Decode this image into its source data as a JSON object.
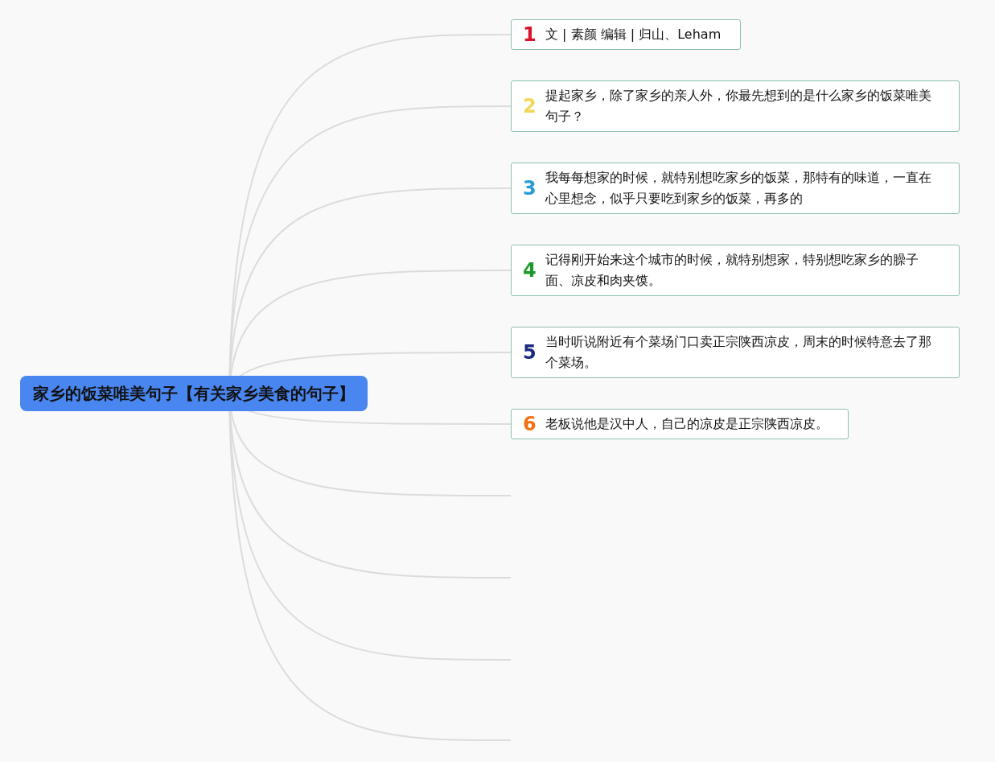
{
  "root": {
    "title": "家乡的饭菜唯美句子【有关家乡美食的句子】"
  },
  "branches": [
    {
      "kind": "topic",
      "marker": "1",
      "color": "#d8142c",
      "text": "文 | 素颜 编辑 | 归山、Leham"
    },
    {
      "kind": "topic",
      "marker": "2",
      "color": "#f2d65a",
      "text": "提起家乡，除了家乡的亲人外，你最先想到的是什么家乡的饭菜唯美句子？"
    },
    {
      "kind": "topic",
      "marker": "3",
      "color": "#2a9bd8",
      "text": "我每每想家的时候，就特别想吃家乡的饭菜，那特有的味道，一直在心里想念，似乎只要吃到家乡的饭菜，再多的"
    },
    {
      "kind": "topic",
      "marker": "4",
      "color": "#1e9a2c",
      "text": "记得刚开始来这个城市的时候，就特别想家，特别想吃家乡的臊子面、凉皮和肉夹馍。"
    },
    {
      "kind": "topic",
      "marker": "5",
      "color": "#1b2a7e",
      "text": "当时听说附近有个菜场门口卖正宗陕西凉皮，周末的时候特意去了那个菜场。"
    },
    {
      "kind": "topic",
      "marker": "6",
      "color": "#f47012",
      "text": "老板说他是汉中人，自己的凉皮是正宗陕西凉皮。"
    },
    {
      "kind": "empty"
    },
    {
      "kind": "empty"
    },
    {
      "kind": "empty"
    },
    {
      "kind": "empty"
    }
  ]
}
